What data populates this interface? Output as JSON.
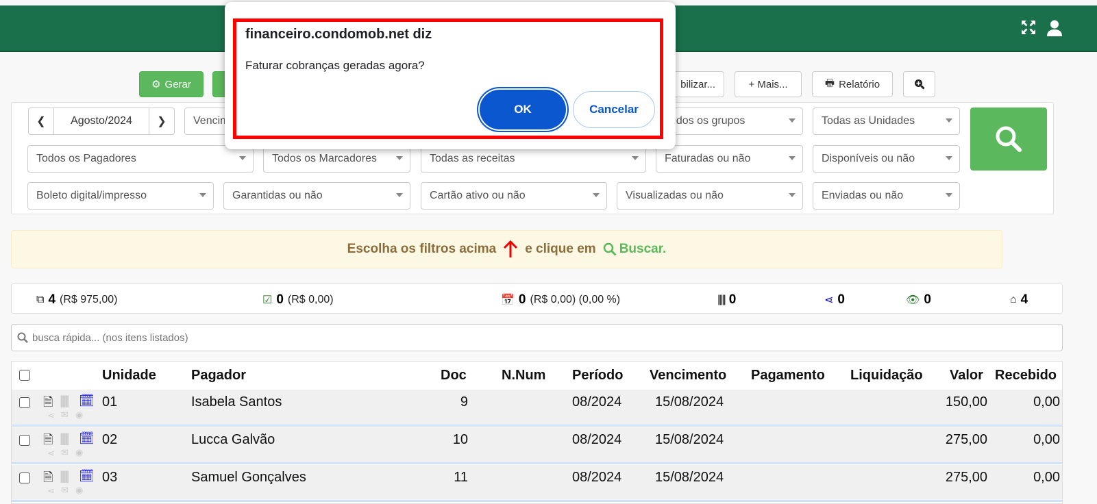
{
  "colors": {
    "header": "#19704a",
    "success": "#5cb85c",
    "danger": "#e00000",
    "primary": "#0b57d0",
    "warning_text": "#8a6d3b"
  },
  "header": {
    "icons": [
      "expand-icon",
      "user-icon"
    ]
  },
  "toolbar": {
    "gerar": "Gerar",
    "bilizar": "bilizar...",
    "mais": "+ Mais...",
    "relatorio": "Relatório"
  },
  "filters": {
    "month": "Agosto/2024",
    "data_tipo": "Vencimento",
    "grupos": "Todos os grupos",
    "unidades": "Todas as Unidades",
    "pagadores": "Todos os Pagadores",
    "marcadores": "Todos os Marcadores",
    "receitas": "Todas as receitas",
    "faturadas": "Faturadas ou não",
    "disponiveis": "Disponíveis ou não",
    "boleto": "Boleto digital/impresso",
    "garantidas": "Garantidas ou não",
    "cartao": "Cartão ativo ou não",
    "visualizadas": "Visualizadas ou não",
    "enviadas": "Enviadas ou não"
  },
  "alert": {
    "part1": "Escolha os filtros acima",
    "part2": "e clique em",
    "part3": "Buscar."
  },
  "stats": {
    "total_count": "4",
    "total_value": "(R$ 975,00)",
    "paid_count": "0",
    "paid_value": "(R$ 0,00)",
    "late_count": "0",
    "late_value": "(R$ 0,00) (0,00 %)",
    "barcode_count": "0",
    "shared_count": "0",
    "viewed_count": "0",
    "units_count": "4"
  },
  "quick_search": {
    "placeholder": "busca rápida... (nos itens listados)"
  },
  "table": {
    "headers": {
      "unidade": "Unidade",
      "pagador": "Pagador",
      "doc": "Doc",
      "nnum": "N.Num",
      "periodo": "Período",
      "vencimento": "Vencimento",
      "pagamento": "Pagamento",
      "liquidacao": "Liquidação",
      "valor": "Valor",
      "recebido": "Recebido"
    },
    "rows": [
      {
        "unidade": "01",
        "pagador": "Isabela Santos",
        "doc": "9",
        "nnum": "",
        "periodo": "08/2024",
        "vencimento": "15/08/2024",
        "pagamento": "",
        "liquidacao": "",
        "valor": "150,00",
        "recebido": "0,00"
      },
      {
        "unidade": "02",
        "pagador": "Lucca Galvão",
        "doc": "10",
        "nnum": "",
        "periodo": "08/2024",
        "vencimento": "15/08/2024",
        "pagamento": "",
        "liquidacao": "",
        "valor": "275,00",
        "recebido": "0,00"
      },
      {
        "unidade": "03",
        "pagador": "Samuel Gonçalves",
        "doc": "11",
        "nnum": "",
        "periodo": "08/2024",
        "vencimento": "15/08/2024",
        "pagamento": "",
        "liquidacao": "",
        "valor": "275,00",
        "recebido": "0,00"
      }
    ]
  },
  "dialog": {
    "title": "financeiro.condomob.net diz",
    "message": "Faturar cobranças geradas agora?",
    "ok": "OK",
    "cancel": "Cancelar"
  }
}
